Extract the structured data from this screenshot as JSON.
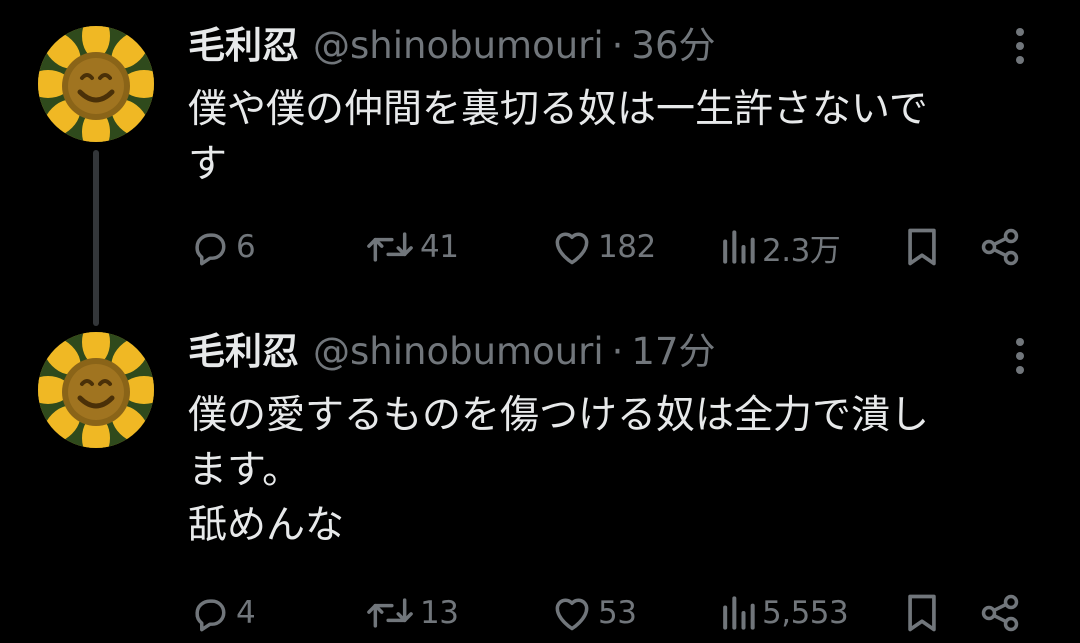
{
  "tweets": [
    {
      "display_name": "毛利忍",
      "handle": "@shinobumouri",
      "separator": "·",
      "time": "36分",
      "text_lines": [
        "僕や僕の仲間を裏切る奴は一生許さないで",
        "す"
      ],
      "replies": "6",
      "retweets": "41",
      "likes": "182",
      "views": "2.3万",
      "icons": {
        "avatar": "sunflower-avatar",
        "more": "more-vertical-icon",
        "reply": "reply-icon",
        "retweet": "retweet-icon",
        "like": "heart-icon",
        "views": "views-chart-icon",
        "bookmark": "bookmark-icon",
        "share": "share-icon"
      }
    },
    {
      "display_name": "毛利忍",
      "handle": "@shinobumouri",
      "separator": "·",
      "time": "17分",
      "text_lines": [
        "僕の愛するものを傷つける奴は全力で潰し",
        "ます。",
        "舐めんな"
      ],
      "replies": "4",
      "retweets": "13",
      "likes": "53",
      "views": "5,553",
      "icons": {
        "avatar": "sunflower-avatar",
        "more": "more-vertical-icon",
        "reply": "reply-icon",
        "retweet": "retweet-icon",
        "like": "heart-icon",
        "views": "views-chart-icon",
        "bookmark": "bookmark-icon",
        "share": "share-icon"
      }
    }
  ],
  "colors": {
    "background": "#000000",
    "primary_text": "#e7e9ea",
    "secondary_text": "#71767b",
    "thread_line": "#333639"
  }
}
